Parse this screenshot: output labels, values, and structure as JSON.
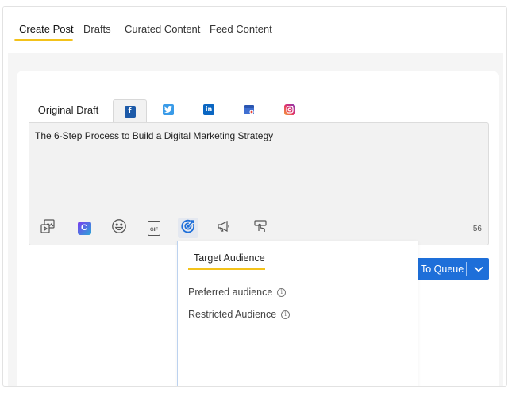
{
  "top_tabs": [
    {
      "label": "Create Post",
      "active": true
    },
    {
      "label": "Drafts",
      "active": false
    },
    {
      "label": "Curated Content",
      "active": false
    },
    {
      "label": "Feed Content",
      "active": false
    }
  ],
  "draft_tabs": {
    "original_label": "Original Draft",
    "networks": [
      {
        "icon": "facebook-icon",
        "glyph": "f",
        "color": "#1d5aa8",
        "active": true
      },
      {
        "icon": "twitter-icon",
        "glyph": "t",
        "color": "#3a9be8",
        "active": false
      },
      {
        "icon": "linkedin-icon",
        "glyph": "in",
        "color": "#0a66c2",
        "active": false
      },
      {
        "icon": "google-business-icon",
        "glyph": "",
        "color": "#3f6fd1",
        "active": false
      },
      {
        "icon": "instagram-icon",
        "glyph": "",
        "color": "#d6367a",
        "active": false
      }
    ]
  },
  "editor": {
    "text": "The 6-Step Process to Build a Digital Marketing Strategy",
    "char_count": "56",
    "tools": [
      "media-icon",
      "canva-icon",
      "emoji-icon",
      "gif-icon",
      "target-audience-icon",
      "announcement-icon",
      "hand-pointer-icon"
    ],
    "canva_glyph": "C",
    "gif_glyph": "GIF"
  },
  "queue_button": {
    "label": "To Queue"
  },
  "target_audience_popup": {
    "title": "Target Audience",
    "options": [
      "Preferred audience",
      "Restricted Audience"
    ],
    "info_glyph": "i"
  },
  "colors": {
    "accent": "#f3c21a",
    "primary": "#1e6fd9"
  }
}
